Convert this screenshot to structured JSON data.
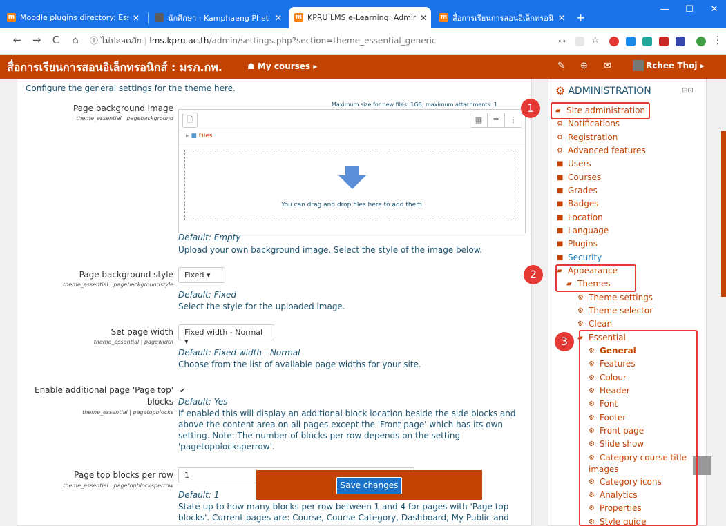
{
  "browser": {
    "tabs": [
      {
        "title": "Moodle plugins directory: Essent",
        "favicon_color": "#f98012",
        "favicon_text": "m"
      },
      {
        "title": "นักศึกษา : Kamphaeng Phet Rajab",
        "favicon_color": "#5b5b5b",
        "favicon_text": ""
      },
      {
        "title": "KPRU LMS e-Learning: Administr",
        "favicon_color": "#f98012",
        "favicon_text": "m"
      },
      {
        "title": "สื่อการเรียนการสอนอิเล็กทรอนิกส์ : มร",
        "favicon_color": "#f98012",
        "favicon_text": "m"
      }
    ],
    "new_tab": "+",
    "window_controls": {
      "minimize": "—",
      "maximize": "☐",
      "close": "✕"
    },
    "nav": {
      "back": "←",
      "forward": "→",
      "reload": "C",
      "home": "⌂"
    },
    "url": {
      "security": "ⓘ ไม่ปลอดภัย",
      "host": "lms.kpru.ac.th",
      "path": "/admin/settings.php?section=theme_essential_generic"
    }
  },
  "navbar": {
    "site_title": "สื่อการเรียนการสอนอิเล็กทรอนิกส์ : มรภ.กพ.",
    "my_courses": "My courses ▸",
    "user": "Rchee Thoj ▸"
  },
  "settings": {
    "intro": "Configure the general settings for the theme here.",
    "max_size": "Maximum size for new files: 1GB, maximum attachments: 1",
    "bg_image": {
      "label": "Page background image",
      "name": "theme_essential | pagebackground",
      "files_label": "Files",
      "drop_text": "You can drag and drop files here to add them.",
      "default": "Default: Empty",
      "desc": "Upload your own background image. Select the style of the image below."
    },
    "bg_style": {
      "label": "Page background style",
      "name": "theme_essential | pagebackgroundstyle",
      "value": "Fixed  ▾",
      "default": "Default: Fixed",
      "desc": "Select the style for the uploaded image."
    },
    "page_width": {
      "label": "Set page width",
      "name": "theme_essential | pagewidth",
      "value": "Fixed width - Normal  ▾",
      "default": "Default: Fixed width - Normal",
      "desc": "Choose from the list of available page widths for your site."
    },
    "page_top": {
      "label": "Enable additional page 'Page top'",
      "label2": "blocks",
      "name": "theme_essential | pagetopblocks",
      "check": "✔",
      "default": "Default: Yes",
      "desc": "If enabled this will display an additional block location beside the side blocks and above the content area on all pages except the 'Front page' which has its own setting. Note: The number of blocks per row depends on the setting 'pagetopblocksperrow'."
    },
    "blocks_per_row": {
      "label": "Page top blocks per row",
      "name": "theme_essential | pagetopblocksperrow",
      "value": "1",
      "default": "Default: 1",
      "desc": "State up to how many blocks per row between 1 and 4 for pages with 'Page top blocks'. Current pages are: Course, Course Category, Dashboard, My Public and"
    },
    "save": "Save changes"
  },
  "admin": {
    "title": "ADMINISTRATION",
    "items": [
      {
        "label": "Site administration",
        "icon": "open-folder"
      },
      {
        "label": "Notifications",
        "icon": "gear"
      },
      {
        "label": "Registration",
        "icon": "gear"
      },
      {
        "label": "Advanced features",
        "icon": "gear"
      },
      {
        "label": "Users",
        "icon": "folder"
      },
      {
        "label": "Courses",
        "icon": "folder"
      },
      {
        "label": "Grades",
        "icon": "folder"
      },
      {
        "label": "Badges",
        "icon": "folder"
      },
      {
        "label": "Location",
        "icon": "folder"
      },
      {
        "label": "Language",
        "icon": "folder"
      },
      {
        "label": "Plugins",
        "icon": "folder"
      },
      {
        "label": "Security",
        "icon": "folder"
      },
      {
        "label": "Appearance",
        "icon": "open-folder"
      },
      {
        "label": "Themes",
        "icon": "open-folder"
      },
      {
        "label": "Theme settings",
        "icon": "gear"
      },
      {
        "label": "Theme selector",
        "icon": "gear"
      },
      {
        "label": "Clean",
        "icon": "gear"
      },
      {
        "label": "Essential",
        "icon": "open-folder"
      },
      {
        "label": "General",
        "icon": "gear"
      },
      {
        "label": "Features",
        "icon": "gear"
      },
      {
        "label": "Colour",
        "icon": "gear"
      },
      {
        "label": "Header",
        "icon": "gear"
      },
      {
        "label": "Font",
        "icon": "gear"
      },
      {
        "label": "Footer",
        "icon": "gear"
      },
      {
        "label": "Front page",
        "icon": "gear"
      },
      {
        "label": "Slide show",
        "icon": "gear"
      },
      {
        "label": "Category course title",
        "icon": "gear"
      },
      {
        "label": "images",
        "icon": "none"
      },
      {
        "label": "Category icons",
        "icon": "gear"
      },
      {
        "label": "Analytics",
        "icon": "gear"
      },
      {
        "label": "Properties",
        "icon": "gear"
      },
      {
        "label": "Style guide",
        "icon": "gear"
      }
    ]
  },
  "annotations": {
    "b1": "1",
    "b2": "2",
    "b3": "3"
  },
  "colors": {
    "brand": "#c34303",
    "chrome": "#1a73e8",
    "annotation": "#e53935",
    "link": "#1d5571"
  }
}
